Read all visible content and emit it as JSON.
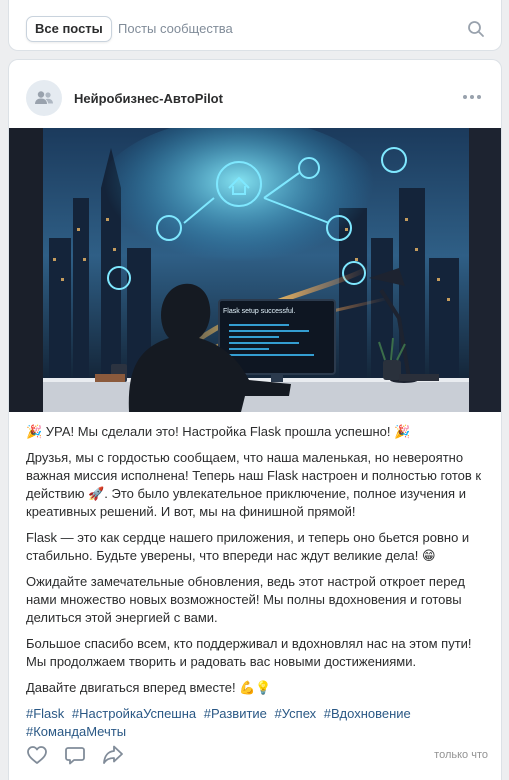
{
  "tabs": {
    "all_posts": "Все посты",
    "community_posts": "Посты сообщества"
  },
  "post": {
    "author": "Нейробизнес-АвтоPilot",
    "image_caption": "Flask setup successful.",
    "lines": [
      "🎉 УРА! Мы сделали это! Настройка Flask прошла успешно! 🎉",
      "Друзья, мы с гордостью сообщаем, что наша маленькая, но невероятно важная миссия исполнена! Теперь наш Flask настроен и полностью готов к действию 🚀. Это было увлекательное приключение, полное изучения и креативных решений. И вот, мы на финишной прямой!",
      "Flask — это как сердце нашего приложения, и теперь оно бьется ровно и стабильно. Будьте уверены, что впереди нас ждут великие дела! 😁",
      "Ожидайте замечательные обновления, ведь этот настрой откроет перед нами множество новых возможностей! Мы полны вдохновения и готовы делиться этой энергией с вами.",
      "Большое спасибо всем, кто поддерживал и вдохновлял нас на этом пути! Мы продолжаем творить и радовать вас новыми достижениями.",
      "Давайте двигаться вперед вместе! 💪💡"
    ],
    "hashtags": [
      "#Flask",
      "#НастройкаУспешна",
      "#Развитие",
      "#Успех",
      "#Вдохновение",
      "#КомандаМечты"
    ],
    "time": "только что"
  },
  "colors": {
    "accent": "#2a5885",
    "background": "#edeef0",
    "icon": "#818c99"
  },
  "icons": {
    "search": "search-icon",
    "more": "more-icon",
    "avatar": "community-icon",
    "like": "heart-icon",
    "comment": "comment-icon",
    "share": "share-icon"
  }
}
